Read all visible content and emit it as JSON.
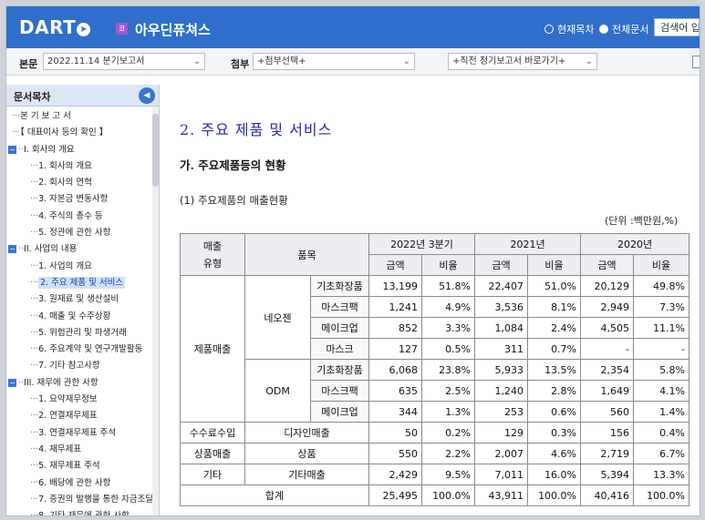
{
  "header": {
    "logo": "DART",
    "market_badge": "코",
    "company": "아우딘퓨쳐스",
    "radio_current": "현재목차",
    "radio_all": "전체문서",
    "search_button": "검색어 입"
  },
  "selectors": {
    "report_label": "본문",
    "report_value": "2022.11.14  분기보고서",
    "attach_label": "첨부",
    "attach_value": "+첨부선택+",
    "recent_value": "+직전 정기보고서 바로가기+"
  },
  "sidebar": {
    "title": "문서목차",
    "items": [
      {
        "label": "본 기 보 고 서",
        "level": 0
      },
      {
        "label": "【 대표이사 등의 확인 】",
        "level": 0
      },
      {
        "label": "I. 회사의 개요",
        "level": "sec"
      },
      {
        "label": "1. 회사의 개요",
        "level": 1
      },
      {
        "label": "2. 회사의 연혁",
        "level": 1
      },
      {
        "label": "3. 자본금 변동사항",
        "level": 1
      },
      {
        "label": "4. 주식의 총수 등",
        "level": 1
      },
      {
        "label": "5. 정관에 관한 사항",
        "level": 1
      },
      {
        "label": "II. 사업의 내용",
        "level": "sec"
      },
      {
        "label": "1. 사업의 개요",
        "level": 1
      },
      {
        "label": "2. 주요 제품 및 서비스",
        "level": 1,
        "active": true
      },
      {
        "label": "3. 원재료 및 생산설비",
        "level": 1
      },
      {
        "label": "4. 매출 및 수주상황",
        "level": 1
      },
      {
        "label": "5. 위험관리 및 파생거래",
        "level": 1
      },
      {
        "label": "6. 주요계약 및 연구개발활동",
        "level": 1
      },
      {
        "label": "7. 기타 참고사항",
        "level": 1
      },
      {
        "label": "III. 재무에 관한 사항",
        "level": "sec"
      },
      {
        "label": "1. 요약재무정보",
        "level": 1
      },
      {
        "label": "2. 연결재무제표",
        "level": 1
      },
      {
        "label": "3. 연결재무제표 주석",
        "level": 1
      },
      {
        "label": "4. 재무제표",
        "level": 1
      },
      {
        "label": "5. 재무제표 주석",
        "level": 1
      },
      {
        "label": "6. 배당에 관한 사항",
        "level": 1
      },
      {
        "label": "7. 증권의 발행을 통한 자금조달",
        "level": 1
      },
      {
        "label": "8. 기타 재무에 관한 사항",
        "level": 1
      }
    ]
  },
  "content": {
    "title": "2. 주요 제품 및 서비스",
    "subtitle": "가. 주요제품등의 현황",
    "section": "(1) 주요제품의 매출현황",
    "unit": "(단위 :백만원,%)",
    "table": {
      "h_type": "매출\n유형",
      "h_item": "품목",
      "h_p1": "2022년 3분기",
      "h_p2": "2021년",
      "h_p3": "2020년",
      "h_amt": "금액",
      "h_ratio": "비율",
      "product_sales": "제품매출",
      "neoj": "네오젠",
      "odm": "ODM",
      "rows": [
        {
          "item": "기초화장품",
          "a1": "13,199",
          "r1": "51.8%",
          "a2": "22,407",
          "r2": "51.0%",
          "a3": "20,129",
          "r3": "49.8%"
        },
        {
          "item": "마스크팩",
          "a1": "1,241",
          "r1": "4.9%",
          "a2": "3,536",
          "r2": "8.1%",
          "a3": "2,949",
          "r3": "7.3%"
        },
        {
          "item": "메이크업",
          "a1": "852",
          "r1": "3.3%",
          "a2": "1,084",
          "r2": "2.4%",
          "a3": "4,505",
          "r3": "11.1%"
        },
        {
          "item": "마스크",
          "a1": "127",
          "r1": "0.5%",
          "a2": "311",
          "r2": "0.7%",
          "a3": "-",
          "r3": "-"
        },
        {
          "item": "기초화장품",
          "a1": "6,068",
          "r1": "23.8%",
          "a2": "5,933",
          "r2": "13.5%",
          "a3": "2,354",
          "r3": "5.8%"
        },
        {
          "item": "마스크팩",
          "a1": "635",
          "r1": "2.5%",
          "a2": "1,240",
          "r2": "2.8%",
          "a3": "1,649",
          "r3": "4.1%"
        },
        {
          "item": "메이크업",
          "a1": "344",
          "r1": "1.3%",
          "a2": "253",
          "r2": "0.6%",
          "a3": "560",
          "r3": "1.4%"
        }
      ],
      "fee": {
        "type": "수수료수입",
        "item": "디자인매출",
        "a1": "50",
        "r1": "0.2%",
        "a2": "129",
        "r2": "0.3%",
        "a3": "156",
        "r3": "0.4%"
      },
      "goods": {
        "type": "상품매출",
        "item": "상품",
        "a1": "550",
        "r1": "2.2%",
        "a2": "2,007",
        "r2": "4.6%",
        "a3": "2,719",
        "r3": "6.7%"
      },
      "etc": {
        "type": "기타",
        "item": "기타매출",
        "a1": "2,429",
        "r1": "9.5%",
        "a2": "7,011",
        "r2": "16.0%",
        "a3": "5,394",
        "r3": "13.3%"
      },
      "total": {
        "label": "합계",
        "a1": "25,495",
        "r1": "100.0%",
        "a2": "43,911",
        "r2": "100.0%",
        "a3": "40,416",
        "r3": "100.0%"
      }
    }
  }
}
